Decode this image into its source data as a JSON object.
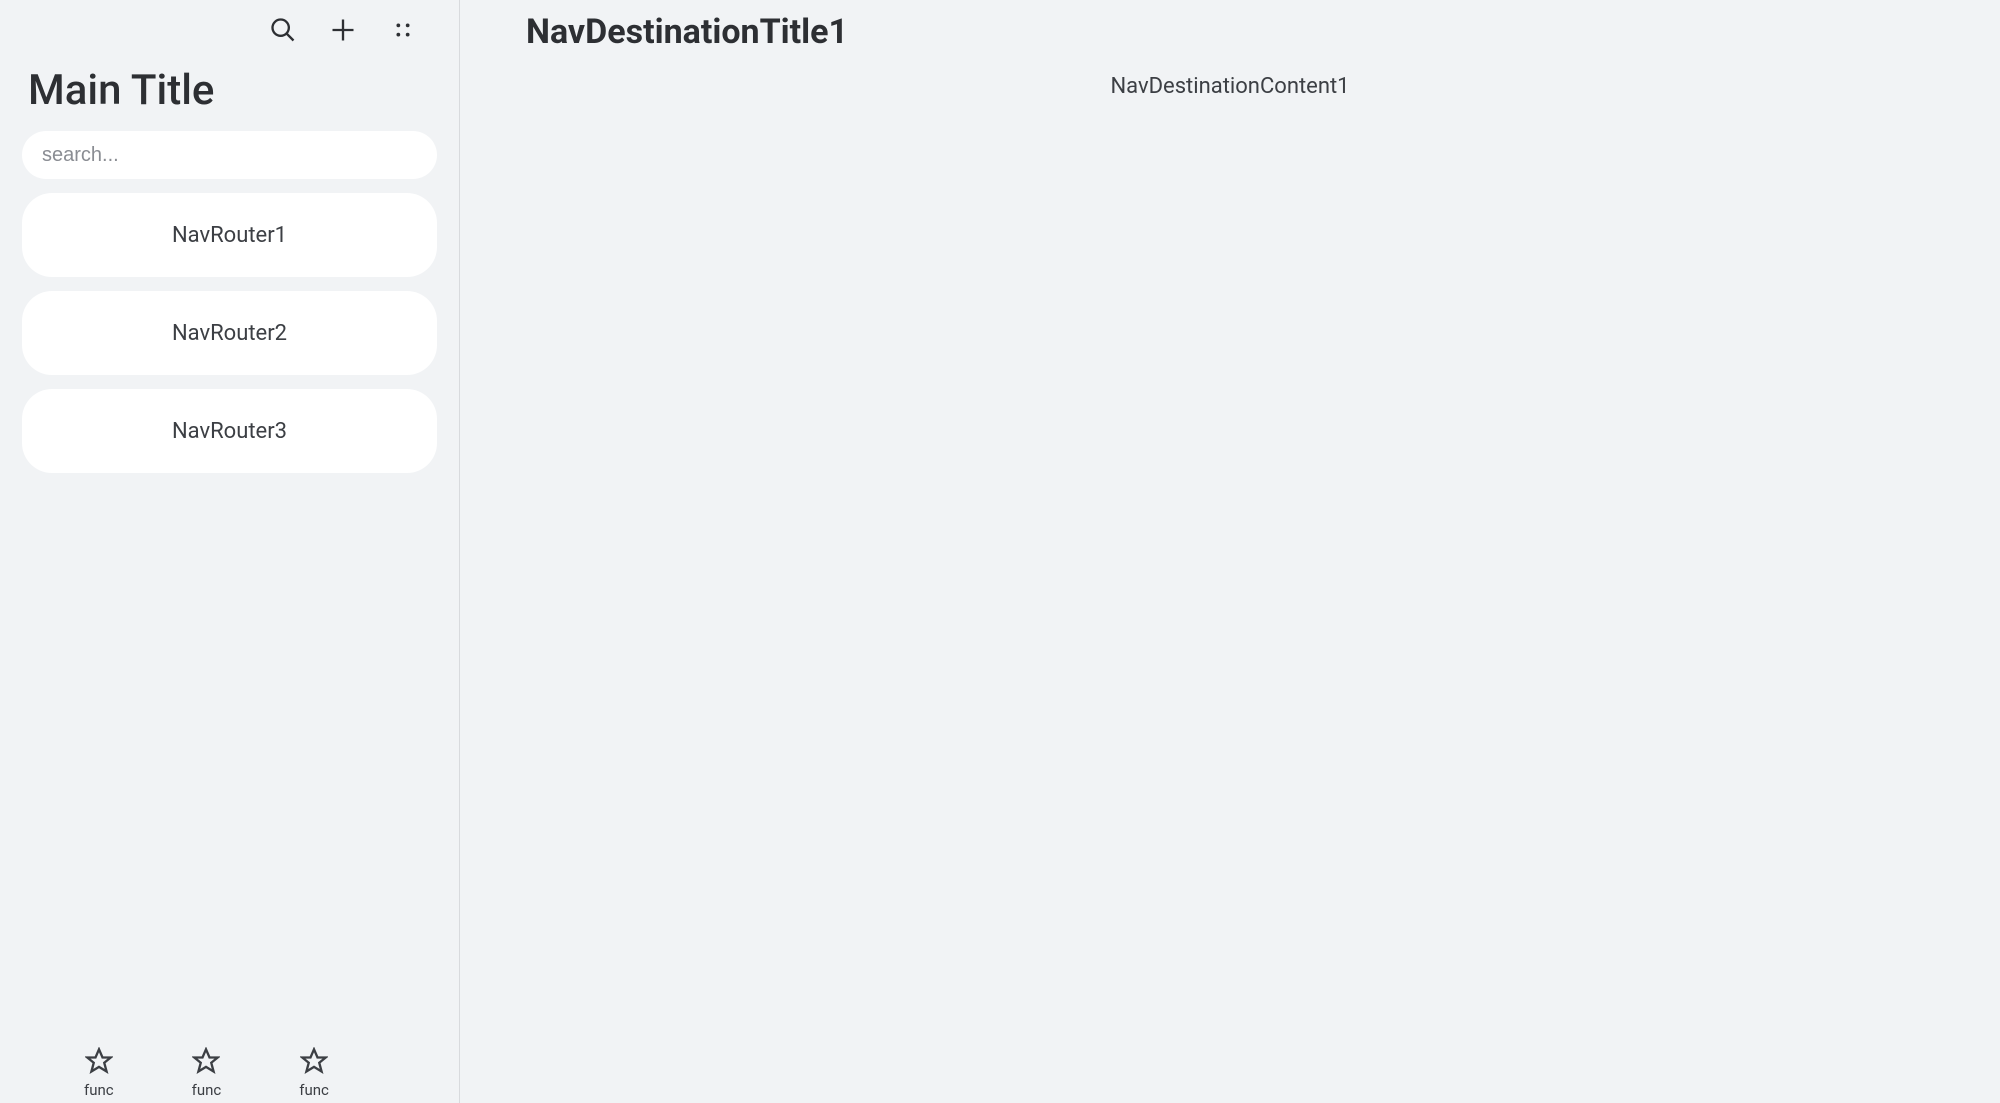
{
  "sidebar": {
    "title": "Main Title",
    "search_placeholder": "search...",
    "nav_items": [
      {
        "label": "NavRouter1"
      },
      {
        "label": "NavRouter2"
      },
      {
        "label": "NavRouter3"
      }
    ],
    "bottom_tabs": [
      {
        "label": "func"
      },
      {
        "label": "func"
      },
      {
        "label": "func"
      }
    ]
  },
  "content": {
    "title": "NavDestinationTitle1",
    "body": "NavDestinationContent1"
  }
}
